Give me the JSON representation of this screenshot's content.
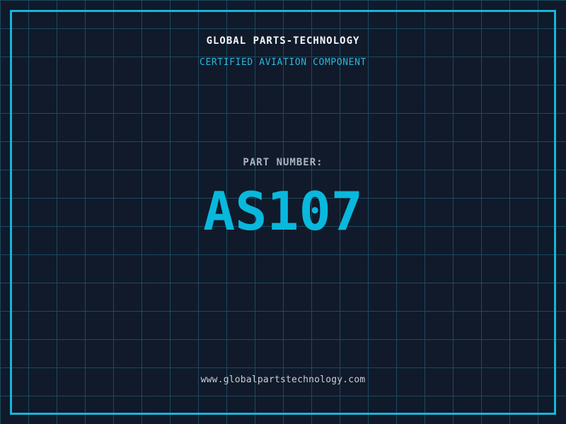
{
  "theme": {
    "bg": "#101a2a",
    "grid": "#1d4a60",
    "frame": "#18b4da",
    "title": "#f2f6f9",
    "subtitle": "#2db6db",
    "label": "#a9b4c1",
    "number": "#09b8dd",
    "footer": "#c7ced7"
  },
  "header": {
    "title": "GLOBAL PARTS-TECHNOLOGY",
    "subtitle": "CERTIFIED AVIATION COMPONENT"
  },
  "part": {
    "label": "PART NUMBER:",
    "number": "AS107"
  },
  "footer": {
    "url": "www.globalpartstechnology.com"
  }
}
